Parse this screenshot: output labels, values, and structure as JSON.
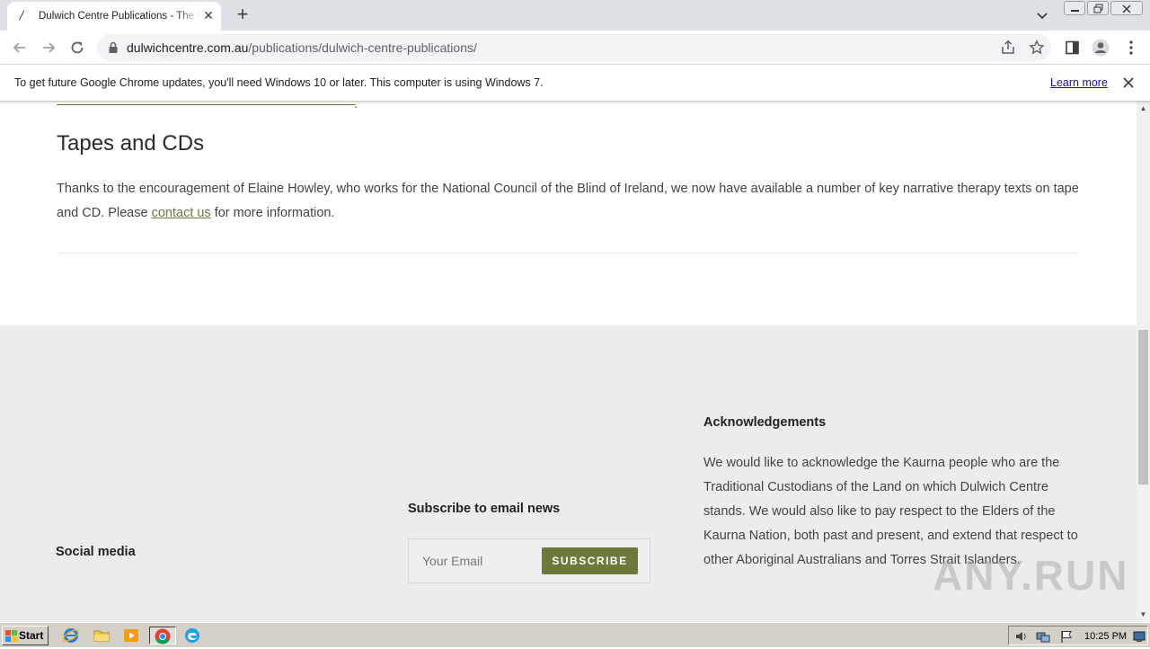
{
  "browser": {
    "tab_title": "Dulwich Centre Publications - The Dulwich Centre",
    "tab_favicon": "/",
    "new_tab_label": "+",
    "close_tab_label": "✕",
    "url_host": "dulwichcentre.com.au",
    "url_path": "/publications/dulwich-centre-publications/"
  },
  "infobar": {
    "message": "To get future Google Chrome updates, you'll need Windows 10 or later. This computer is using Windows 7.",
    "link_label": "Learn more"
  },
  "page": {
    "section_title": "Tapes and CDs",
    "body_before": "Thanks to the encouragement of Elaine Howley, who works for the National Council of the Blind of Ireland, we now have available a number of key narrative therapy texts on tape and CD. Please ",
    "body_link": "contact us",
    "body_after": " for more information.",
    "cut_dot": ".",
    "footer": {
      "ack_heading": "Acknowledgements",
      "ack_text": "We would like to acknowledge the Kaurna people who are the Traditional Custodians of the Land on which Dulwich Centre stands. We would also like to pay respect to the Elders of the Kaurna Nation, both past and present, and extend that respect to other Aboriginal Australians and Torres Strait Islanders.",
      "subscribe_heading": "Subscribe to email news",
      "email_placeholder": "Your Email",
      "subscribe_button": "SUBSCRIBE",
      "social_heading": "Social media"
    },
    "watermark": "ANY.RUN"
  },
  "taskbar": {
    "start_label": "Start",
    "clock": "10:25 PM"
  },
  "colors": {
    "accent_olive": "#6b7a3a",
    "footer_bg": "#ececec",
    "link_blue": "#1a0dab"
  }
}
